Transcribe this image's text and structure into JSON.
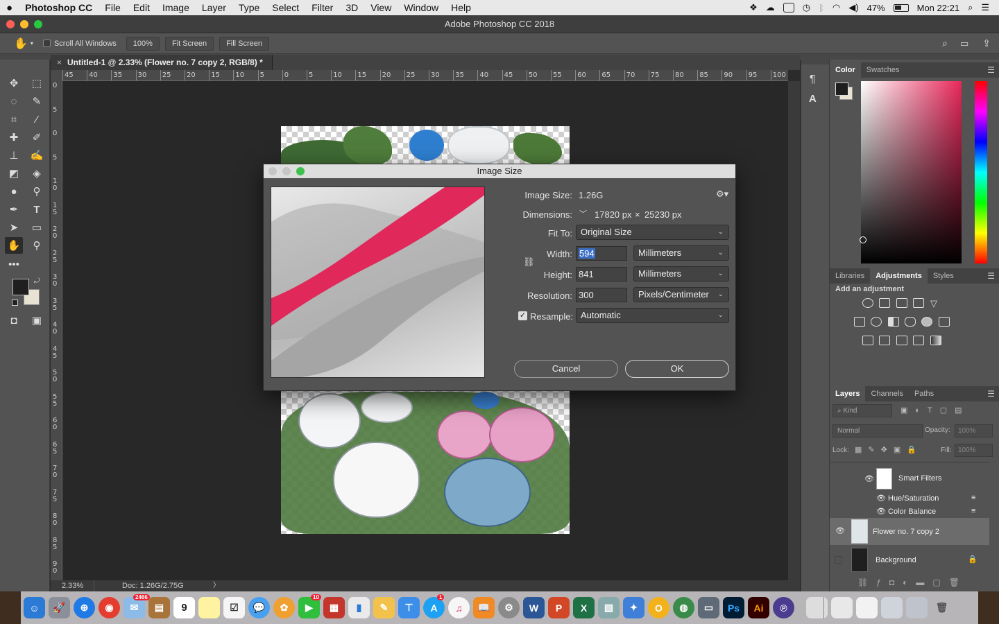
{
  "menubar": {
    "apple_icon": "apple-icon",
    "app_name": "Photoshop CC",
    "items": [
      "File",
      "Edit",
      "Image",
      "Layer",
      "Type",
      "Select",
      "Filter",
      "3D",
      "View",
      "Window",
      "Help"
    ],
    "battery": "47%",
    "clock": "Mon 22:21"
  },
  "window": {
    "title": "Adobe Photoshop CC 2018"
  },
  "options": {
    "scroll_all": "Scroll All Windows",
    "zoom_btn": "100%",
    "fit_screen": "Fit Screen",
    "fill_screen": "Fill Screen"
  },
  "document": {
    "tab_title": "Untitled-1 @ 2.33% (Flower no. 7 copy 2, RGB/8) *",
    "zoom": "2.33%",
    "doc_size": "Doc: 1.26G/2.75G"
  },
  "rulers": {
    "h_ticks": [
      "45",
      "40",
      "35",
      "30",
      "25",
      "20",
      "15",
      "10",
      "5",
      "0",
      "5",
      "10",
      "15",
      "20",
      "25",
      "30",
      "35",
      "40",
      "45",
      "50",
      "55",
      "60",
      "65",
      "70",
      "75",
      "80",
      "85",
      "90",
      "95",
      "100"
    ],
    "v_ticks": [
      "0",
      "5",
      "0",
      "5",
      "1 0",
      "1 5",
      "2 0",
      "2 5",
      "3 0",
      "3 5",
      "4 0",
      "4 5",
      "5 0",
      "5 5",
      "6 0",
      "6 5",
      "7 0",
      "7 5",
      "8 0",
      "8 5",
      "9 0"
    ]
  },
  "dialog": {
    "title": "Image Size",
    "image_size_label": "Image Size:",
    "image_size_value": "1.26G",
    "dimensions_label": "Dimensions:",
    "dim_w": "17820 px",
    "dim_x": "×",
    "dim_h": "25230 px",
    "fit_to_label": "Fit To:",
    "fit_to_value": "Original Size",
    "width_label": "Width:",
    "width_value": "594",
    "width_unit": "Millimeters",
    "height_label": "Height:",
    "height_value": "841",
    "height_unit": "Millimeters",
    "resolution_label": "Resolution:",
    "resolution_value": "300",
    "resolution_unit": "Pixels/Centimeter",
    "resample_label": "Resample:",
    "resample_checked": true,
    "resample_value": "Automatic",
    "cancel": "Cancel",
    "ok": "OK"
  },
  "panels": {
    "color_tabs": [
      "Color",
      "Swatches"
    ],
    "adjust_tabs": [
      "Libraries",
      "Adjustments",
      "Styles"
    ],
    "add_adjustment": "Add an adjustment",
    "layers_tabs": [
      "Layers",
      "Channels",
      "Paths"
    ],
    "kind": "Kind",
    "blend_mode": "Normal",
    "opacity_label": "Opacity:",
    "opacity_value": "100%",
    "lock_label": "Lock:",
    "fill_label": "Fill:",
    "fill_value": "100%",
    "layers": {
      "smart_filters": "Smart Filters",
      "hue_sat": "Hue/Saturation",
      "color_balance": "Color Balance",
      "flower": "Flower no. 7 copy 2",
      "background": "Background"
    }
  },
  "dock": {
    "calendar_day": "9",
    "mail_badge": "2466",
    "badge_10": "10",
    "badge_1": "1",
    "ps": "Ps",
    "ai": "Ai"
  },
  "colors": {
    "accent_red": "#e8285a",
    "dialog_bg": "#535353"
  }
}
